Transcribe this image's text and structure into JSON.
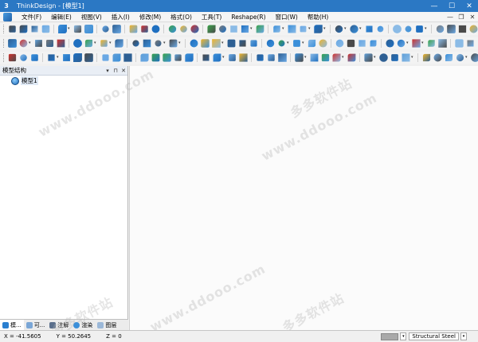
{
  "window": {
    "app_glyph": "3",
    "title": "ThinkDesign  - [模型1]",
    "minimize": "—",
    "maximize": "☐",
    "close": "✕"
  },
  "menu": {
    "items": [
      "文件(F)",
      "编辑(E)",
      "视图(V)",
      "插入(I)",
      "修改(M)",
      "格式(O)",
      "工具(T)",
      "Reshape(R)",
      "窗口(W)",
      "帮助(H)"
    ],
    "mdi_minimize": "—",
    "mdi_restore": "❐",
    "mdi_close": "✕"
  },
  "panel": {
    "title": "模型结构",
    "dropdown": "▾",
    "pin": "⊓",
    "close": "✕",
    "tree_root": "模型1",
    "tabs": [
      "模...",
      "可...",
      "注解",
      "渲染",
      "图层"
    ]
  },
  "watermarks": [
    "www.ddooo.com",
    "多多软件站",
    "www.ddooo.com",
    "多多软件站",
    "www.ddooo.com",
    "多多软件站"
  ],
  "status": {
    "x": "X = -41.5605",
    "y": "Y = 50.2645",
    "z": "Z = 0",
    "dropdown_glyph": "▾",
    "material": "Structural Steel"
  },
  "colors": {
    "titlebar": "#2b78c4",
    "accent_blue": "#1f6fc0",
    "accent_red": "#d0312d"
  }
}
